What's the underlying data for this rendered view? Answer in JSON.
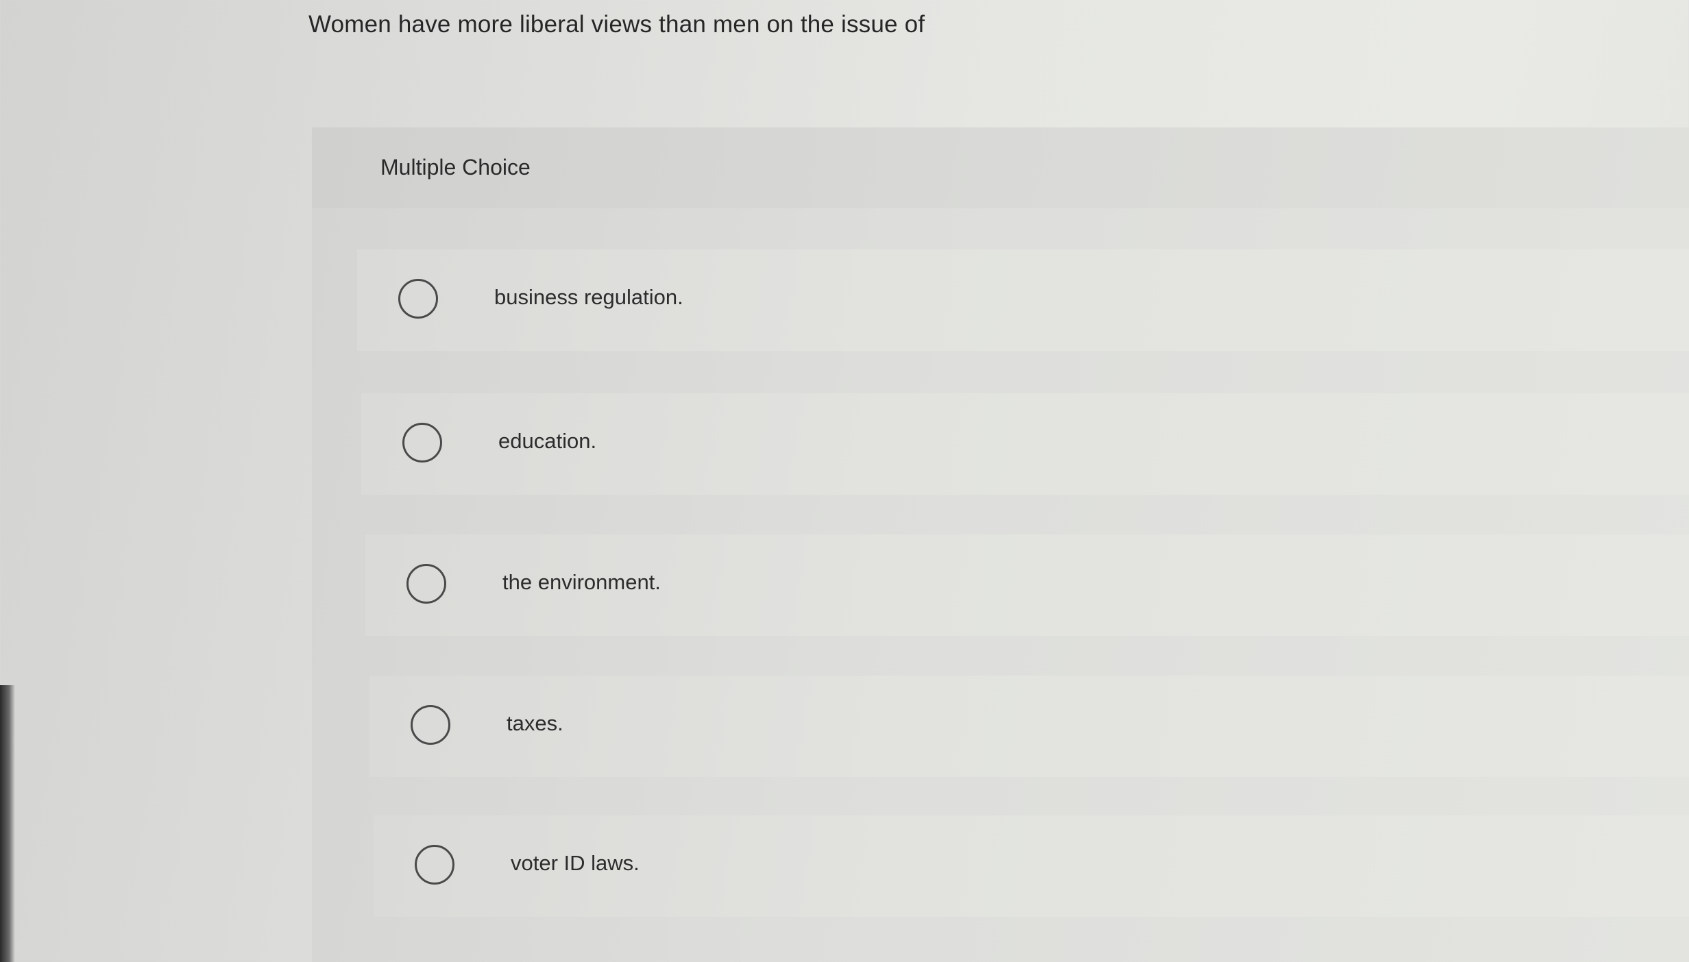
{
  "question": {
    "text": "Women have more liberal views than men on the issue of"
  },
  "panel": {
    "header_label": "Multiple Choice"
  },
  "choices": [
    {
      "label": "business regulation."
    },
    {
      "label": "education."
    },
    {
      "label": "the environment."
    },
    {
      "label": "taxes."
    },
    {
      "label": "voter ID laws."
    }
  ]
}
